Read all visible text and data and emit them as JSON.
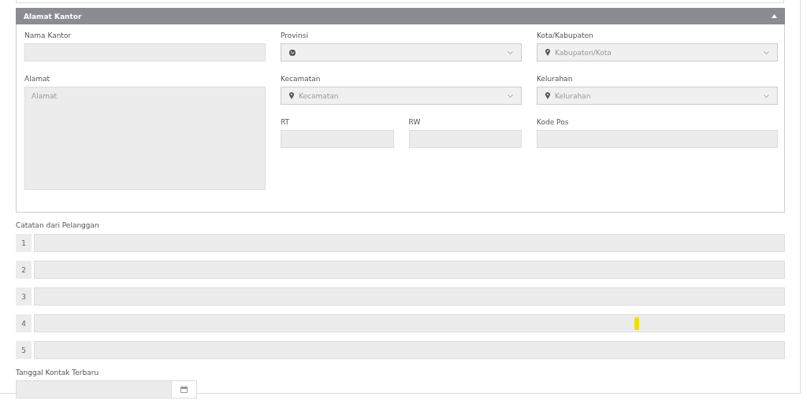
{
  "section": {
    "title": "Alamat Kantor",
    "expanded": true
  },
  "office_name": {
    "label": "Nama Kantor"
  },
  "address": {
    "label": "Alamat",
    "placeholder": "Alamat"
  },
  "selects": [
    {
      "label": "Provinsi"
    },
    {
      "label": "Kota/Kabupaten",
      "placeholder": "Kabupaten/Kota"
    },
    {
      "label": "Kecamatan",
      "placeholder": "Kecamatan"
    },
    {
      "label": "Kelurahan",
      "placeholder": "Kelurahan"
    }
  ],
  "small_fields": [
    {
      "label": "RT"
    },
    {
      "label": "RW"
    },
    {
      "label": "Kode Pos"
    }
  ],
  "notes": {
    "label": "Catatan dari Pelanggan",
    "rows": [
      {
        "number": "1"
      },
      {
        "number": "2"
      },
      {
        "number": "3"
      },
      {
        "number": "4"
      },
      {
        "number": "5"
      }
    ]
  },
  "last_contact": {
    "label": "Tanggal Kontak Terbaru"
  }
}
